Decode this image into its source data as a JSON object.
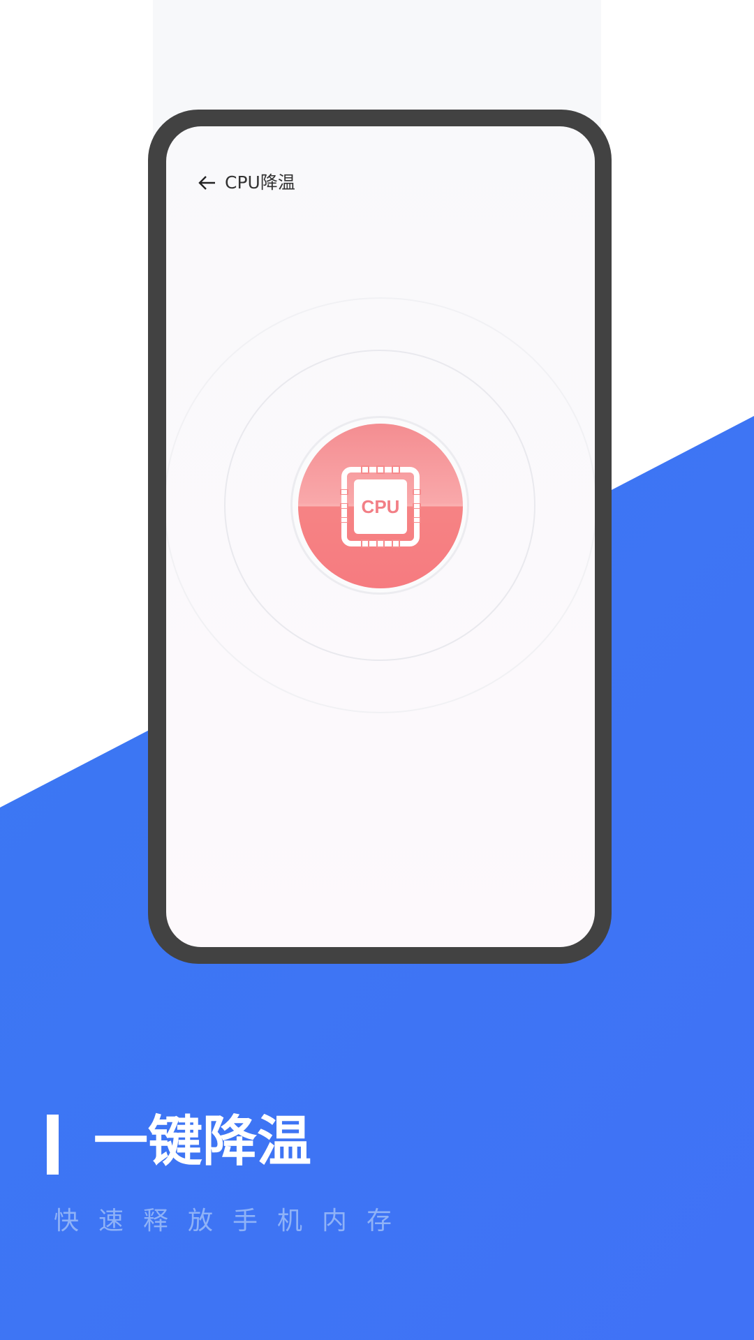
{
  "colors": {
    "brand_blue": "#3f73f3",
    "frame": "#424242",
    "cpu_red": "#f67b80"
  },
  "app_screen": {
    "back_icon": "arrow-left-icon",
    "title": "CPU降温",
    "chip_icon": "cpu-chip-icon",
    "chip_label": "CPU"
  },
  "promo": {
    "headline": "一键降温",
    "subtitle": "快速释放手机内存"
  }
}
